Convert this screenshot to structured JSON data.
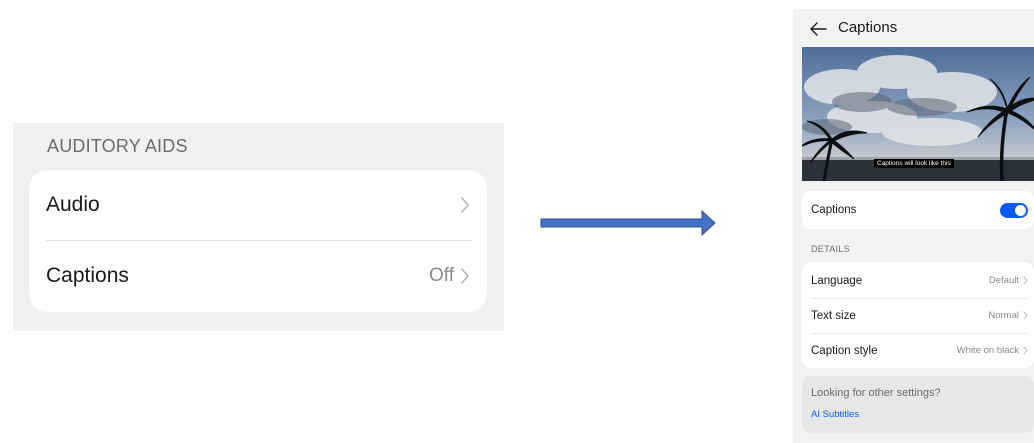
{
  "left_panel": {
    "section_header": "AUDITORY AIDS",
    "items": [
      {
        "label": "Audio",
        "value": ""
      },
      {
        "label": "Captions",
        "value": "Off"
      }
    ]
  },
  "phone": {
    "title": "Captions",
    "preview_caption": "Captions will look like this",
    "captions_toggle": {
      "label": "Captions",
      "state": "on"
    },
    "details_header": "DETAILS",
    "details": [
      {
        "label": "Language",
        "value": "Default"
      },
      {
        "label": "Text size",
        "value": "Normal"
      },
      {
        "label": "Caption style",
        "value": "White on black"
      }
    ],
    "other_settings": {
      "title": "Looking for other settings?",
      "link": "AI Subtitles"
    }
  },
  "colors": {
    "accent_blue": "#0a59f7",
    "arrow_fill": "#4472c4",
    "arrow_stroke": "#2f528f"
  },
  "icons": [
    "chevron-right-icon",
    "back-arrow-icon",
    "toggle-switch",
    "right-arrow"
  ]
}
